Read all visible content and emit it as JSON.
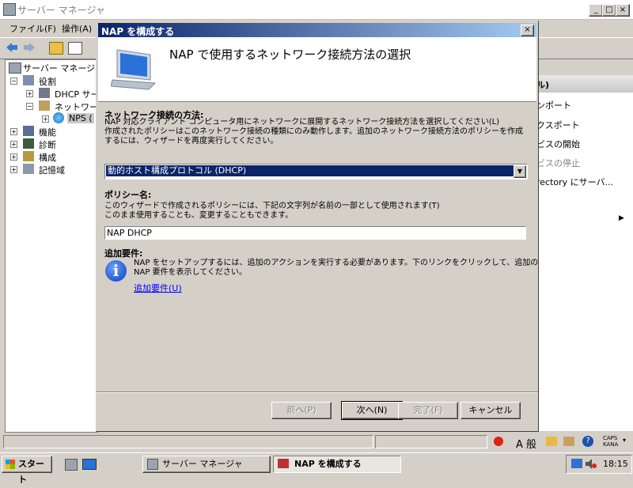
{
  "main_window": {
    "title": "サーバー マネージャ",
    "menu": [
      "ファイル(F)",
      "操作(A)"
    ],
    "tree": {
      "root": "サーバー マネージャ",
      "roles": "役割",
      "dhcp": "DHCP サー",
      "network": "ネットワーク",
      "nps": "NPS (",
      "features": "機能",
      "diagnostics": "診断",
      "configuration": "構成",
      "storage": "記憶域"
    },
    "actions": {
      "header": "ル)",
      "items": [
        "ンポート",
        "クスポート",
        "ビスの開始",
        "ビスの停止",
        "rectory にサーバ..."
      ]
    }
  },
  "dialog": {
    "title": "NAP を構成する",
    "close": "×",
    "heading": "NAP で使用するネットワーク接続方法の選択",
    "method_label": "ネットワーク接続の方法:",
    "method_desc": [
      "NAP 対応クライアント コンピュータ用にネットワークに展開するネットワーク接続方法を選択してください(L)",
      "作成されたポリシーはこのネットワーク接続の種類にのみ動作します。追加のネットワーク接続方法のポリシーを作成",
      "するには、ウィザードを再度実行してください。"
    ],
    "method_selected": "動的ホスト構成プロトコル (DHCP)",
    "policy_label": "ポリシー名:",
    "policy_desc": [
      "このウィザードで作成されるポリシーには、下記の文字列が名前の一部として使用されます(T)",
      "このまま使用することも、変更することもできます。"
    ],
    "policy_value": "NAP DHCP",
    "req_label": "追加要件:",
    "req_desc": [
      "NAP をセットアップするには、追加のアクションを実行する必要があります。下のリンクをクリックして、追加の",
      "NAP 要件を表示してください。"
    ],
    "req_link": "追加要件(U)",
    "buttons": {
      "back": "前へ(P)",
      "next": "次へ(N)",
      "finish": "完了(F)",
      "cancel": "キャンセル"
    }
  },
  "taskbar": {
    "start": "スタート",
    "tasks": [
      "サーバー マネージャ",
      "NAP を構成する"
    ],
    "ime": "A 般",
    "caps": "CAPS",
    "kana": "KANA",
    "clock": "18:15"
  }
}
